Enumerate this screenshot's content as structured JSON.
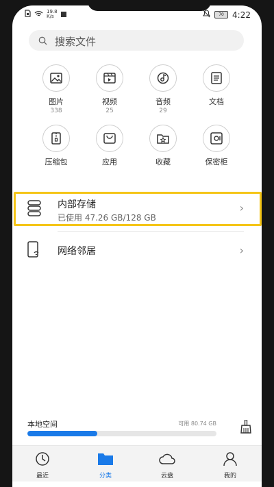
{
  "statusbar": {
    "speed_value": "19.8",
    "speed_unit": "K/s",
    "battery": "70",
    "time": "4:22"
  },
  "search": {
    "placeholder": "搜索文件"
  },
  "categories": [
    {
      "label": "图片",
      "count": "338",
      "icon": "image-icon"
    },
    {
      "label": "视频",
      "count": "25",
      "icon": "video-icon"
    },
    {
      "label": "音频",
      "count": "29",
      "icon": "audio-icon"
    },
    {
      "label": "文档",
      "count": "",
      "icon": "document-icon"
    },
    {
      "label": "压缩包",
      "count": "",
      "icon": "zip-icon"
    },
    {
      "label": "应用",
      "count": "",
      "icon": "app-bag-icon"
    },
    {
      "label": "收藏",
      "count": "",
      "icon": "favorite-folder-icon"
    },
    {
      "label": "保密柜",
      "count": "",
      "icon": "safe-icon"
    }
  ],
  "storage": {
    "title": "内部存储",
    "usage": "已使用 47.26 GB/128 GB"
  },
  "network": {
    "title": "网络邻居"
  },
  "local_space": {
    "title": "本地空间",
    "free": "可用 80.74 GB",
    "used_fraction": 0.37
  },
  "colors": {
    "accent": "#1a7ae8",
    "highlight": "#f5c518"
  },
  "tabs": [
    {
      "label": "最近",
      "icon": "clock-icon",
      "active": false
    },
    {
      "label": "分类",
      "icon": "folder-icon",
      "active": true
    },
    {
      "label": "云盘",
      "icon": "cloud-icon",
      "active": false
    },
    {
      "label": "我的",
      "icon": "person-icon",
      "active": false
    }
  ]
}
